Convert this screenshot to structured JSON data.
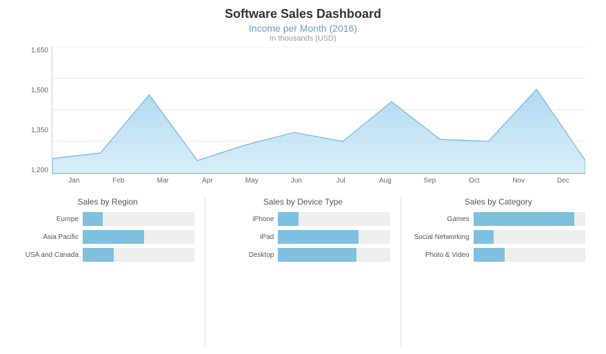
{
  "title": "Software Sales Dashboard",
  "income_chart": {
    "title": "Income per Month (2016)",
    "subtitle": "In thousands (USD)",
    "y_labels": [
      "1,650",
      "1,500",
      "1,350",
      "1,200"
    ],
    "x_labels": [
      "Jan",
      "Feb",
      "Mar",
      "Apr",
      "May",
      "Jun",
      "Jul",
      "Aug",
      "Sep",
      "Oct",
      "Nov",
      "Dec"
    ],
    "grid_lines": [
      0,
      1,
      2,
      3
    ]
  },
  "region_chart": {
    "title": "Sales by Region",
    "bars": [
      {
        "label": "Europe",
        "value": 18
      },
      {
        "label": "Asia Pacific",
        "value": 55
      },
      {
        "label": "USA and Canada",
        "value": 28
      }
    ]
  },
  "device_chart": {
    "title": "Sales by Device Type",
    "bars": [
      {
        "label": "iPhone",
        "value": 18
      },
      {
        "label": "iPad",
        "value": 72
      },
      {
        "label": "Desktop",
        "value": 70
      }
    ]
  },
  "category_chart": {
    "title": "Sales by Category",
    "bars": [
      {
        "label": "Games",
        "value": 90
      },
      {
        "label": "Social Networking",
        "value": 18
      },
      {
        "label": "Photo & Video",
        "value": 28
      }
    ]
  }
}
